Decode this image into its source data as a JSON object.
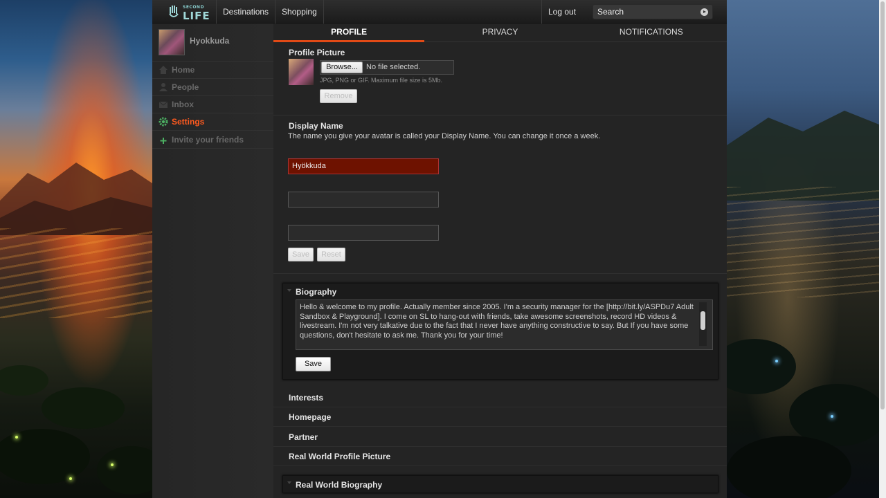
{
  "topbar": {
    "logo_small": "SECOND",
    "logo_text": "LIFE",
    "nav": [
      "Destinations",
      "Shopping"
    ],
    "logout": "Log out",
    "search_placeholder": "Search"
  },
  "sidebar": {
    "username": "Hyokkuda",
    "items": [
      {
        "label": "Home",
        "icon": "home-icon"
      },
      {
        "label": "People",
        "icon": "people-icon"
      },
      {
        "label": "Inbox",
        "icon": "inbox-icon"
      },
      {
        "label": "Settings",
        "icon": "gear-icon",
        "active": true
      },
      {
        "label": "Invite your friends",
        "icon": "plus-icon"
      }
    ]
  },
  "tabs": [
    {
      "label": "PROFILE",
      "active": true
    },
    {
      "label": "PRIVACY"
    },
    {
      "label": "NOTIFICATIONS"
    }
  ],
  "profile_picture": {
    "title": "Profile Picture",
    "browse_label": "Browse...",
    "file_status": "No file selected.",
    "hint": "JPG, PNG or GIF. Maximum file size is 5Mb.",
    "remove_label": "Remove"
  },
  "display_name": {
    "title": "Display Name",
    "description": "The name you give your avatar is called your Display Name. You can change it once a week.",
    "value": "Hyökkuda",
    "field2": "",
    "field3": "",
    "save_label": "Save",
    "reset_label": "Reset"
  },
  "biography": {
    "title": "Biography",
    "text": "Hello & welcome to my profile. Actually member since 2005. I'm a security manager for the [http://bit.ly/ASPDu7 Adult Sandbox & Playground]. I come on SL to hang-out with friends, take awesome screenshots, record HD videos & livestream. I'm not very talkative due to the fact that I never have anything constructive to say. But If you have some questions, don't hesitate to ask me. Thank you for your time!",
    "save_label": "Save"
  },
  "sections": [
    "Interests",
    "Homepage",
    "Partner",
    "Real World Profile Picture"
  ],
  "last_panel": "Real World Biography",
  "colors": {
    "accent": "#e24a16",
    "active_sidebar": "#ff5a1f",
    "error_field": "#6e1200"
  }
}
